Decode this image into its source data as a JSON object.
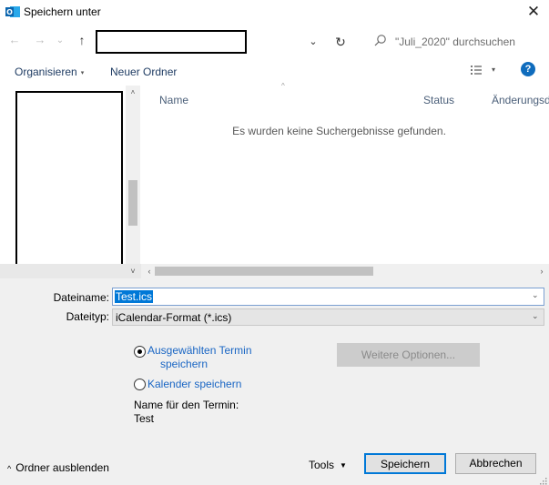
{
  "window": {
    "title": "Speichern unter",
    "close_label": "✕"
  },
  "address": {
    "path_value": "",
    "back_label": "←",
    "forward_label": "→",
    "recent_label": "⌄",
    "up_label": "↑",
    "dropdown_label": "⌄",
    "refresh_label": "↻",
    "search_placeholder": "\"Juli_2020\" durchsuchen"
  },
  "toolbar": {
    "organize_label": "Organisieren",
    "organize_arrow": "▾",
    "new_folder_label": "Neuer Ordner",
    "view_arrow": "▾",
    "help_label": "?"
  },
  "file_list": {
    "columns": [
      "Name",
      "Status",
      "Änderungsdatum"
    ],
    "sort_caret": "^",
    "empty_message": "Es wurden keine Suchergebnisse gefunden."
  },
  "scrollbars": {
    "up": "˄",
    "down": "˅",
    "left": "‹",
    "right": "›"
  },
  "form": {
    "filename_label": "Dateiname:",
    "filename_value": "Test.ics",
    "filename_chevron": "⌄",
    "filetype_label": "Dateityp:",
    "filetype_value": "iCalendar-Format (*.ics)",
    "filetype_chevron": "⌄",
    "radio_selected_line1": "Ausgewählten Termin",
    "radio_selected_line2": "speichern",
    "radio_other": "Kalender speichern",
    "more_options_label": "Weitere Optionen...",
    "term_name_label": "Name für den Termin:",
    "term_name_value": "Test"
  },
  "footer": {
    "hide_folders_label": "Ordner ausblenden",
    "hide_chevron": "^",
    "tools_label": "Tools",
    "tools_arrow": "▼",
    "save_label": "Speichern",
    "cancel_label": "Abbrechen"
  },
  "colors": {
    "accent": "#0078d7",
    "link": "#1a66c4",
    "panel": "#f0f0f0"
  }
}
